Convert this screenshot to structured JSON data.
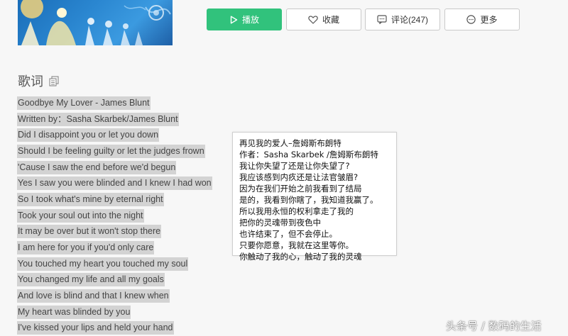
{
  "toolbar": {
    "play_label": "播放",
    "favorite_label": "收藏",
    "comment_label": "评论(247)",
    "more_label": "更多",
    "play_color": "#31c27c"
  },
  "lyrics": {
    "title": "歌词",
    "lines": [
      "Goodbye My Lover - James Blunt",
      "Written by：Sasha Skarbek/James Blunt",
      "Did I disappoint you or let you down",
      "Should I be feeling guilty or let the judges frown",
      "'Cause I saw the end before we'd begun",
      "Yes I saw you were blinded and I knew I had won",
      "So I took what's mine by eternal right",
      "Took your soul out into the night",
      "It may be over but it won't stop there",
      "I am here for you if you'd only care",
      "You touched my heart you touched my soul",
      "You changed my life and all my goals",
      "And love is blind and that I knew when",
      "My heart was blinded by you",
      "I've kissed your lips and held your hand"
    ]
  },
  "translation": {
    "lines": [
      "再见我的爱人–詹姆斯布朗特",
      "作者：Sasha Skarbek /詹姆斯布朗特",
      "我让你失望了还是让你失望了?",
      "我应该感到内疚还是让法官皱眉?",
      "因为在我们开始之前我看到了结局",
      "是的，我看到你瞎了，我知道我赢了。",
      "所以我用永恒的权利拿走了我的",
      "把你的灵魂带到夜色中",
      "也许结束了，但不会停止。",
      "只要你愿意，我就在这里等你。",
      "你触动了我的心，触动了我的灵魂"
    ]
  },
  "watermark": "头条号 / 数码的生活"
}
